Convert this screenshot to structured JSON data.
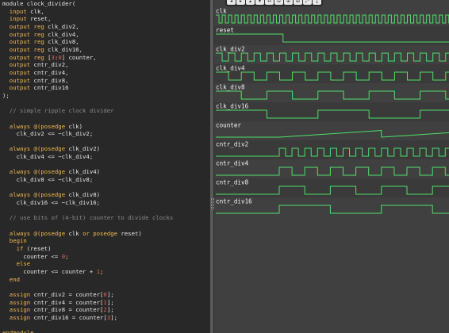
{
  "code_lines": [
    [
      {
        "t": "module clock_divider("
      }
    ],
    [
      {
        "t": "  "
      },
      {
        "t": "input",
        "c": "kw"
      },
      {
        "t": " clk,"
      }
    ],
    [
      {
        "t": "  "
      },
      {
        "t": "input",
        "c": "kw"
      },
      {
        "t": " reset,"
      }
    ],
    [
      {
        "t": "  "
      },
      {
        "t": "output reg",
        "c": "kw"
      },
      {
        "t": " clk_div2,"
      }
    ],
    [
      {
        "t": "  "
      },
      {
        "t": "output reg",
        "c": "kw"
      },
      {
        "t": " clk_div4,"
      }
    ],
    [
      {
        "t": "  "
      },
      {
        "t": "output reg",
        "c": "kw"
      },
      {
        "t": " clk_div8,"
      }
    ],
    [
      {
        "t": "  "
      },
      {
        "t": "output reg",
        "c": "kw"
      },
      {
        "t": " clk_div16,"
      }
    ],
    [
      {
        "t": "  "
      },
      {
        "t": "output reg",
        "c": "kw"
      },
      {
        "t": " ["
      },
      {
        "t": "3",
        "c": "num"
      },
      {
        "t": ":"
      },
      {
        "t": "0",
        "c": "num"
      },
      {
        "t": "] counter,"
      }
    ],
    [
      {
        "t": "  "
      },
      {
        "t": "output",
        "c": "kw"
      },
      {
        "t": " cntr_div2,"
      }
    ],
    [
      {
        "t": "  "
      },
      {
        "t": "output",
        "c": "kw"
      },
      {
        "t": " cntr_div4,"
      }
    ],
    [
      {
        "t": "  "
      },
      {
        "t": "output",
        "c": "kw"
      },
      {
        "t": " cntr_div8,"
      }
    ],
    [
      {
        "t": "  "
      },
      {
        "t": "output",
        "c": "kw"
      },
      {
        "t": " cntr_div16"
      }
    ],
    [
      {
        "t": ");"
      }
    ],
    [
      {
        "t": ""
      }
    ],
    [
      {
        "t": "  "
      },
      {
        "t": "// simple ripple clock divider",
        "c": "cm"
      }
    ],
    [
      {
        "t": ""
      }
    ],
    [
      {
        "t": "  "
      },
      {
        "t": "always @(posedge",
        "c": "kw"
      },
      {
        "t": " clk)"
      }
    ],
    [
      {
        "t": "    clk_div2 <= ~clk_div2;"
      }
    ],
    [
      {
        "t": ""
      }
    ],
    [
      {
        "t": "  "
      },
      {
        "t": "always @(posedge",
        "c": "kw"
      },
      {
        "t": " clk_div2)"
      }
    ],
    [
      {
        "t": "    clk_div4 <= ~clk_div4;"
      }
    ],
    [
      {
        "t": ""
      }
    ],
    [
      {
        "t": "  "
      },
      {
        "t": "always @(posedge",
        "c": "kw"
      },
      {
        "t": " clk_div4)"
      }
    ],
    [
      {
        "t": "    clk_div8 <= ~clk_div8;"
      }
    ],
    [
      {
        "t": ""
      }
    ],
    [
      {
        "t": "  "
      },
      {
        "t": "always @(posedge",
        "c": "kw"
      },
      {
        "t": " clk_div8)"
      }
    ],
    [
      {
        "t": "    clk_div16 <= ~clk_div16;"
      }
    ],
    [
      {
        "t": ""
      }
    ],
    [
      {
        "t": "  "
      },
      {
        "t": "// use bits of (4-bit) counter to divide clocks",
        "c": "cm"
      }
    ],
    [
      {
        "t": ""
      }
    ],
    [
      {
        "t": "  "
      },
      {
        "t": "always @(posedge",
        "c": "kw"
      },
      {
        "t": " clk "
      },
      {
        "t": "or posedge",
        "c": "kw"
      },
      {
        "t": " reset)"
      }
    ],
    [
      {
        "t": "  "
      },
      {
        "t": "begin",
        "c": "kw"
      }
    ],
    [
      {
        "t": "    "
      },
      {
        "t": "if",
        "c": "kw"
      },
      {
        "t": " (reset)"
      }
    ],
    [
      {
        "t": "      counter <= "
      },
      {
        "t": "0",
        "c": "num"
      },
      {
        "t": ";"
      }
    ],
    [
      {
        "t": "    "
      },
      {
        "t": "else",
        "c": "kw"
      }
    ],
    [
      {
        "t": "      counter <= counter + "
      },
      {
        "t": "1",
        "c": "num"
      },
      {
        "t": ";"
      }
    ],
    [
      {
        "t": "  "
      },
      {
        "t": "end",
        "c": "kw"
      }
    ],
    [
      {
        "t": ""
      }
    ],
    [
      {
        "t": "  "
      },
      {
        "t": "assign",
        "c": "kw"
      },
      {
        "t": " cntr_div2 = counter["
      },
      {
        "t": "0",
        "c": "num"
      },
      {
        "t": "];"
      }
    ],
    [
      {
        "t": "  "
      },
      {
        "t": "assign",
        "c": "kw"
      },
      {
        "t": " cntr_div4 = counter["
      },
      {
        "t": "1",
        "c": "num"
      },
      {
        "t": "];"
      }
    ],
    [
      {
        "t": "  "
      },
      {
        "t": "assign",
        "c": "kw"
      },
      {
        "t": " cntr_div8 = counter["
      },
      {
        "t": "2",
        "c": "num"
      },
      {
        "t": "];"
      }
    ],
    [
      {
        "t": "  "
      },
      {
        "t": "assign",
        "c": "kw"
      },
      {
        "t": " cntr_div16 = counter["
      },
      {
        "t": "3",
        "c": "num"
      },
      {
        "t": "];"
      }
    ],
    [
      {
        "t": ""
      }
    ],
    [
      {
        "t": "endmodule",
        "c": "kw"
      }
    ]
  ],
  "toolbar": {
    "buttons": [
      "◂",
      "▸",
      "▴",
      "▾",
      "↔",
      "⊖",
      "⊕",
      "⊞",
      "⤢",
      "⤓"
    ]
  },
  "waveform": {
    "signals": [
      {
        "name": "clk",
        "kind": "clock",
        "period_cycles": 1
      },
      {
        "name": "reset",
        "kind": "reset",
        "release_cycle": 9
      },
      {
        "name": "clk_div2",
        "kind": "clock",
        "period_cycles": 2
      },
      {
        "name": "clk_div4",
        "kind": "clock",
        "period_cycles": 4
      },
      {
        "name": "clk_div8",
        "kind": "clock",
        "period_cycles": 8
      },
      {
        "name": "clk_div16",
        "kind": "clock",
        "period_cycles": 16
      },
      {
        "name": "counter",
        "kind": "analog"
      },
      {
        "name": "cntr_div2",
        "kind": "counter_bit",
        "bit": 0
      },
      {
        "name": "cntr_div4",
        "kind": "counter_bit",
        "bit": 1
      },
      {
        "name": "cntr_div8",
        "kind": "counter_bit",
        "bit": 2
      },
      {
        "name": "cntr_div16",
        "kind": "counter_bit",
        "bit": 3
      }
    ],
    "colors": {
      "wave": "#4fe06a",
      "background": "#404040",
      "row_alt": "#3a3a3a",
      "label": "#f2f2f2"
    }
  }
}
